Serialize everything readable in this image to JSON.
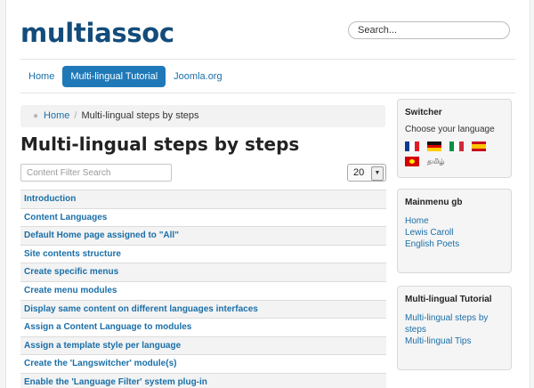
{
  "header": {
    "brand": "multiassoc",
    "search_placeholder": "Search..."
  },
  "nav": {
    "items": [
      {
        "label": "Home"
      },
      {
        "label": "Multi-lingual Tutorial",
        "active": true
      },
      {
        "label": "Joomla.org"
      }
    ]
  },
  "breadcrumb": {
    "home": "Home",
    "separator": "/",
    "current": "Multi-lingual steps by steps"
  },
  "main": {
    "title": "Multi-lingual steps by steps",
    "filter_placeholder": "Content Filter Search",
    "display_count": "20",
    "articles": [
      "Introduction",
      "Content Languages",
      "Default Home page assigned to \"All\"",
      "Site contents structure",
      "Create specific menus",
      "Create menu modules",
      "Display same content on different languages interfaces",
      "Assign a Content Language to modules",
      "Assign a template style per language",
      "Create the 'Langswitcher' module(s)",
      "Enable the 'Language Filter' system plug-in"
    ]
  },
  "sidebar": {
    "switcher": {
      "title": "Switcher",
      "text": "Choose your language",
      "languages": [
        "fr-flag-icon",
        "de-flag-icon",
        "it-flag-icon",
        "es-flag-icon",
        "mk-flag-icon",
        "ta-flag-icon"
      ],
      "tamil_label": "தமிழ்"
    },
    "mainmenu": {
      "title": "Mainmenu gb",
      "links": [
        "Home",
        "Lewis Caroll",
        "English Poets"
      ]
    },
    "tutorial": {
      "title": "Multi-lingual Tutorial",
      "links": [
        "Multi-lingual steps by steps",
        "Multi-lingual Tips"
      ]
    }
  }
}
